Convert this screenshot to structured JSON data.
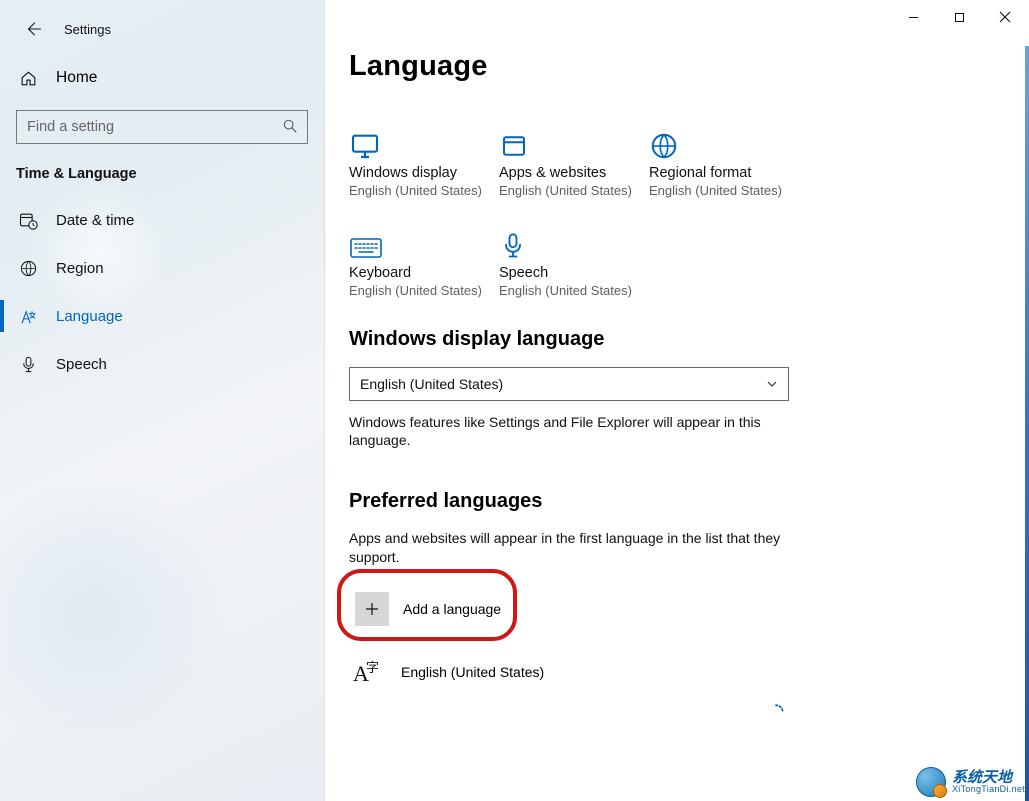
{
  "app": {
    "title": "Settings"
  },
  "sidebar": {
    "home": "Home",
    "search_placeholder": "Find a setting",
    "group": "Time & Language",
    "items": [
      {
        "label": "Date & time"
      },
      {
        "label": "Region"
      },
      {
        "label": "Language"
      },
      {
        "label": "Speech"
      }
    ]
  },
  "page": {
    "title": "Language",
    "tiles": [
      {
        "title": "Windows display",
        "sub": "English (United States)"
      },
      {
        "title": "Apps & websites",
        "sub": "English (United States)"
      },
      {
        "title": "Regional format",
        "sub": "English (United States)"
      },
      {
        "title": "Keyboard",
        "sub": "English (United States)"
      },
      {
        "title": "Speech",
        "sub": "English (United States)"
      }
    ],
    "display_lang": {
      "heading": "Windows display language",
      "selected": "English (United States)",
      "help": "Windows features like Settings and File Explorer will appear in this language."
    },
    "preferred": {
      "heading": "Preferred languages",
      "help": "Apps and websites will appear in the first language in the list that they support.",
      "add": "Add a language",
      "items": [
        {
          "label": "English (United States)"
        }
      ]
    }
  },
  "watermark": {
    "line1": "系统天地",
    "line2": "XiTongTianDi.net"
  }
}
